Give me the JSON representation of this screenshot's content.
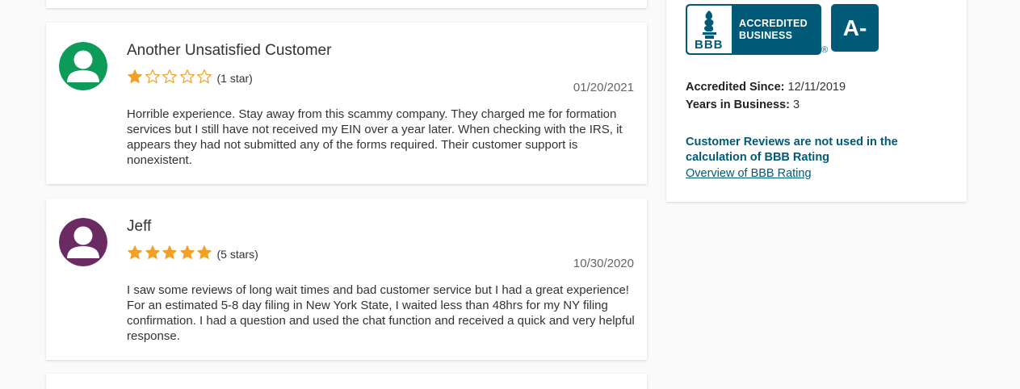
{
  "reviews": [
    {
      "name": "Another Unsatisfied Customer",
      "rating": 1,
      "rating_label": "(1 star)",
      "date": "01/20/2021",
      "text": "Horrible experience. Stay away from this scammy company. They charged me for formation services but I still have not received my EIN over a year later. When checking with the IRS, it appears they had not submitted any of the forms required. Their customer support is nonexistent.",
      "avatar_color": "#0d9b5a"
    },
    {
      "name": "Jeff",
      "rating": 5,
      "rating_label": "(5 stars)",
      "date": "10/30/2020",
      "text": "I saw some reviews of long wait times and bad customer service but I had a great experience! For an estimated 5-8 day filing in New York State, I waited less than 48hrs for my NY filing confirmation. I had a question and used the chat function and received a quick and very helpful response.",
      "avatar_color": "#6a2b63"
    }
  ],
  "sidebar": {
    "logo_text": "BBB",
    "accredited_line1": "ACCREDITED",
    "accredited_line2": "BUSINESS",
    "registered_mark": "®",
    "grade": "A-",
    "accredited_since_label": "Accredited Since:",
    "accredited_since_value": "12/11/2019",
    "years_label": "Years in Business:",
    "years_value": "3",
    "reviews_note": "Customer Reviews are not used in the calculation of BBB Rating",
    "overview_link": "Overview of BBB Rating"
  },
  "colors": {
    "star": "#f0a023",
    "brand": "#005a78"
  }
}
